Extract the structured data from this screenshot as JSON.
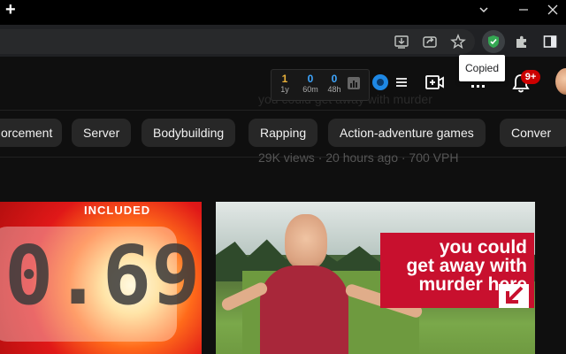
{
  "browser": {
    "new_tab_symbol": "+",
    "tooltip": "Copied",
    "icons": [
      "new-tab-icon",
      "minimize-icon",
      "maximize-icon",
      "close-icon",
      "install-icon",
      "share-icon",
      "bookmark-star-icon",
      "shield-extension-icon",
      "extensions-puzzle-icon",
      "side-panel-icon"
    ]
  },
  "stats": {
    "items": [
      {
        "value": "1",
        "label": "1y",
        "color": "#e8b03a"
      },
      {
        "value": "0",
        "label": "60m",
        "color": "#3ea6ff"
      },
      {
        "value": "0",
        "label": "48h",
        "color": "#3ea6ff"
      }
    ]
  },
  "header": {
    "notification_badge": "9+",
    "faded_title": "you could get away with murder",
    "faded_meta": "29K views · 20 hours ago · 700 VPH"
  },
  "chips": [
    "orcement",
    "Server",
    "Bodybuilding",
    "Rapping",
    "Action-adventure games",
    "Conver"
  ],
  "thumbnails": {
    "left": {
      "counter_text": "0.69",
      "tag_text": "INCLUDED"
    },
    "right": {
      "banner_lines": [
        "you could",
        "get away with",
        "murder here"
      ]
    }
  },
  "colors": {
    "accent_red": "#c8102e",
    "badge_red": "#cc0000",
    "chip_bg": "#272727"
  }
}
